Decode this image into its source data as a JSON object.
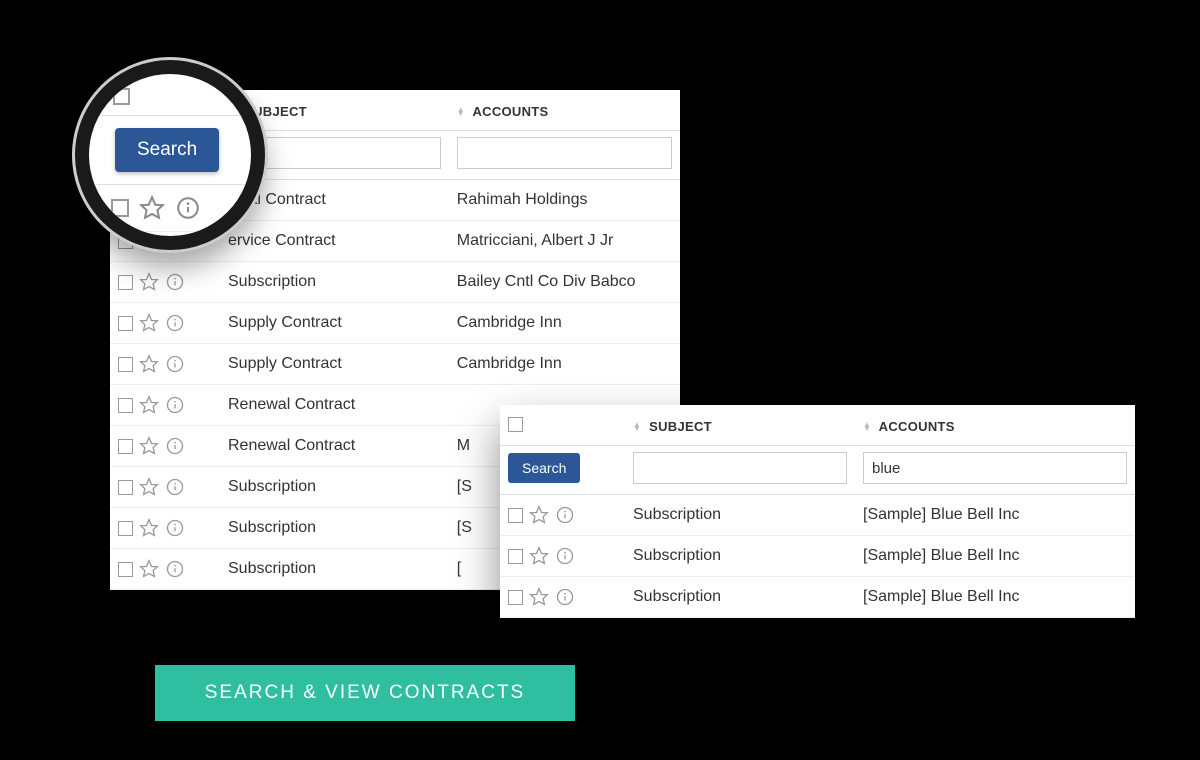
{
  "banner": {
    "label": "SEARCH & VIEW CONTRACTS"
  },
  "buttons": {
    "search": "Search"
  },
  "columns": {
    "subject": "SUBJECT",
    "accounts": "ACCOUNTS"
  },
  "main_table": {
    "filter": {
      "subject": "",
      "accounts": ""
    },
    "rows": [
      {
        "subject": "ewal Contract",
        "account": "Rahimah Holdings"
      },
      {
        "subject": "ervice Contract",
        "account": "Matricciani, Albert J Jr"
      },
      {
        "subject": "Subscription",
        "account": "Bailey Cntl Co Div Babco"
      },
      {
        "subject": "Supply Contract",
        "account": "Cambridge Inn"
      },
      {
        "subject": "Supply Contract",
        "account": "Cambridge Inn"
      },
      {
        "subject": "Renewal Contract",
        "account": ""
      },
      {
        "subject": "Renewal Contract",
        "account": "M"
      },
      {
        "subject": "Subscription",
        "account": "[S"
      },
      {
        "subject": "Subscription",
        "account": "[S"
      },
      {
        "subject": "Subscription",
        "account": "["
      }
    ]
  },
  "secondary_table": {
    "filter": {
      "subject": "",
      "accounts": "blue"
    },
    "rows": [
      {
        "subject": "Subscription",
        "account": "[Sample] Blue Bell Inc"
      },
      {
        "subject": "Subscription",
        "account": "[Sample] Blue Bell Inc"
      },
      {
        "subject": "Subscription",
        "account": "[Sample] Blue Bell Inc"
      }
    ]
  }
}
